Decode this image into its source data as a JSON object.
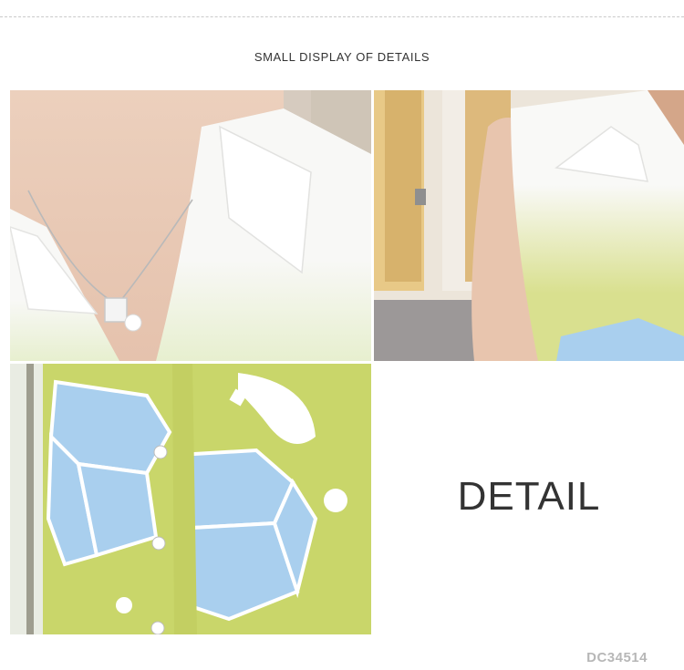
{
  "header": {
    "title": "SMALL DISPLAY OF DETAILS"
  },
  "photos": [
    {
      "name": "collar-necklace-photo"
    },
    {
      "name": "sleeveless-shoulder-photo"
    },
    {
      "name": "ice-cube-print-buttons-photo"
    }
  ],
  "detail_label": "DETAIL",
  "product_code": "DC34514",
  "colors": {
    "print_lime": "#c9d66a",
    "ice_blue": "#a9cfee",
    "shirt_white": "#f7f7f5",
    "text_dark": "#333333",
    "code_gray": "#b7b7b7"
  }
}
